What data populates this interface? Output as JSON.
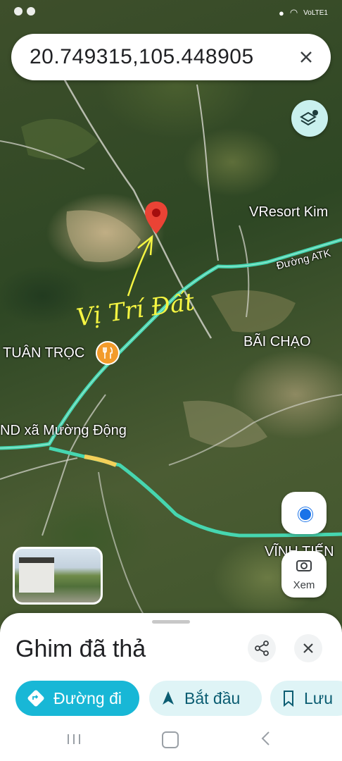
{
  "status_bar": {
    "right_text": "VoLTE1"
  },
  "search": {
    "value": "20.749315,105.448905"
  },
  "map": {
    "labels": {
      "resort": "VResort Kim",
      "road": "Đường ATK",
      "annotation": "Vị Trí Đất",
      "bai_chao": "BÃI CHẠO",
      "tuan_troc": "TUÂN TRỌC",
      "commune": "ND xã Mường Động",
      "vinh_tien": "VĨNH TIẾN"
    },
    "colors": {
      "pin": "#ea4335",
      "highway": "#46d6b0",
      "annotation": "#f5f542"
    }
  },
  "controls": {
    "xem_label": "Xem"
  },
  "sheet": {
    "title": "Ghim đã thả",
    "actions": {
      "directions": "Đường đi",
      "start": "Bắt đầu",
      "save": "Lưu"
    }
  },
  "icons": [
    "layers-icon",
    "close-icon",
    "share-icon",
    "directions-icon",
    "navigate-icon",
    "bookmark-icon",
    "camera-icon",
    "my-location-icon",
    "restaurant-icon",
    "map-pin-icon"
  ]
}
